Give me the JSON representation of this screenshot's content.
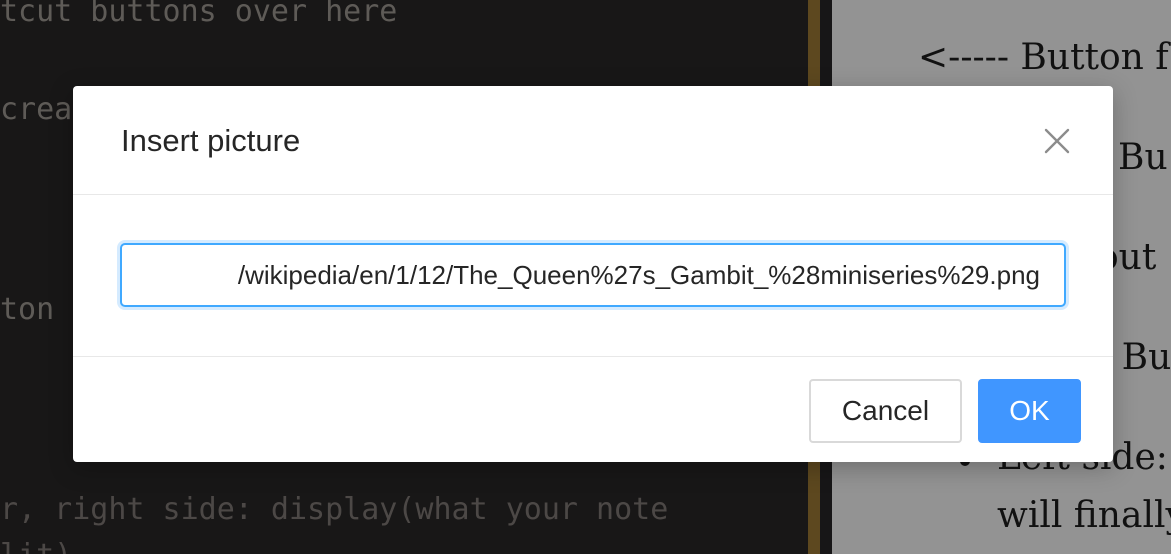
{
  "editor": {
    "lines": [
      "tcut buttons over here",
      "crea",
      "ton",
      "r, right side: display(what your note",
      "lit)"
    ]
  },
  "preview": {
    "lines": [
      "<----- Button f",
      "Bu",
      "out",
      "u Bu",
      "Left side:",
      "will finally"
    ]
  },
  "dialog": {
    "title": "Insert picture",
    "input_value": "/wikipedia/en/1/12/The_Queen%27s_Gambit_%28miniseries%29.png",
    "cancel_label": "Cancel",
    "ok_label": "OK"
  },
  "colors": {
    "primary": "#4096ff",
    "focus_border": "#40a9ff",
    "scroll_accent": "#8a6a2e"
  }
}
